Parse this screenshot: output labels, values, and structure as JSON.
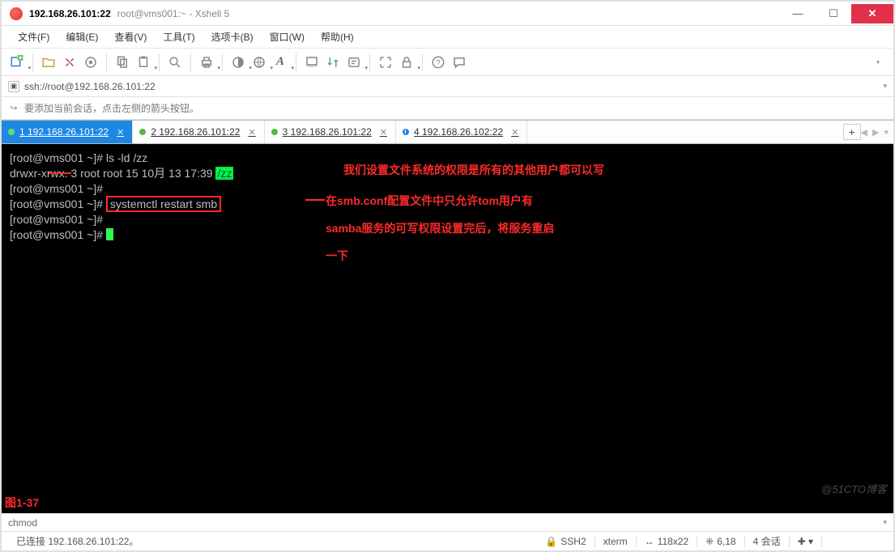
{
  "title": {
    "host": "192.168.26.101:22",
    "sub": "root@vms001:~ - Xshell 5"
  },
  "menu": {
    "file": "文件(F)",
    "edit": "编辑(E)",
    "view": "查看(V)",
    "tools": "工具(T)",
    "tabs": "选项卡(B)",
    "window": "窗口(W)",
    "help": "帮助(H)"
  },
  "addr": {
    "url": "ssh://root@192.168.26.101:22"
  },
  "hint": {
    "text": "要添加当前会话，点击左侧的箭头按钮。"
  },
  "tabs": [
    {
      "num": "1",
      "label": "192.168.26.101:22",
      "active": true,
      "dotClass": "green"
    },
    {
      "num": "2",
      "label": "192.168.26.101:22",
      "active": false,
      "dotClass": "green"
    },
    {
      "num": "3",
      "label": "192.168.26.101:22",
      "active": false,
      "dotClass": "green"
    },
    {
      "num": "4",
      "label": "192.168.26.102:22",
      "active": false,
      "dotClass": "blue"
    }
  ],
  "term": {
    "l1": {
      "prompt": "[root@vms001 ~]# ",
      "cmd": "ls -ld /zz"
    },
    "l2": {
      "out": "drwxr-xrwx. 3 root root 15 10月 13 17:39 ",
      "dir": "/zz"
    },
    "l3": {
      "prompt": "[root@vms001 ~]#"
    },
    "l4": {
      "prompt": "[root@vms001 ~]# ",
      "boxed": "systemctl restart smb"
    },
    "l5": {
      "prompt": "[root@vms001 ~]#"
    },
    "l6": {
      "prompt": "[root@vms001 ~]# "
    }
  },
  "anno": {
    "a1": "我们设置文件系统的权限是所有的其他用户都可以写",
    "a2": "在smb.conf配置文件中只允许tom用户有",
    "a3": "samba服务的可写权限设置完后，将服务重启",
    "a4": "一下",
    "fig": "图1-37"
  },
  "prestatus": {
    "text": "chmod"
  },
  "status": {
    "conn": "已连接 192.168.26.101:22。",
    "proto": "SSH2",
    "termtype": "xterm",
    "size": "118x22",
    "pos": "6,18",
    "sessions": "4 会话"
  },
  "watermark": "@51CTO博客"
}
